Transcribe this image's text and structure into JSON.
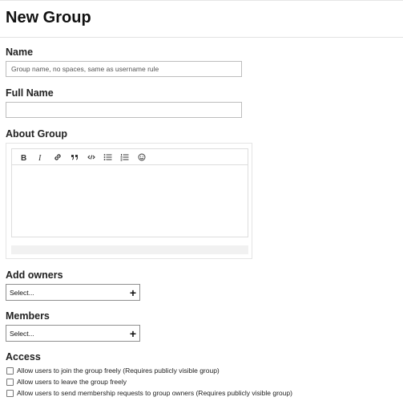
{
  "page": {
    "title": "New Group"
  },
  "fields": {
    "name": {
      "label": "Name",
      "placeholder": "Group name, no spaces, same as username rule",
      "value": ""
    },
    "full_name": {
      "label": "Full Name",
      "placeholder": "",
      "value": ""
    },
    "about": {
      "label": "About Group",
      "toolbar": [
        "bold-icon",
        "italic-icon",
        "link-icon",
        "quote-icon",
        "code-icon",
        "bullet-list-icon",
        "numbered-list-icon",
        "emoji-icon"
      ],
      "value": ""
    },
    "owners": {
      "label": "Add owners",
      "selected": "Select..."
    },
    "members": {
      "label": "Members",
      "selected": "Select..."
    }
  },
  "access": {
    "label": "Access",
    "options": [
      {
        "label": "Allow users to join the group freely (Requires publicly visible group)",
        "checked": false
      },
      {
        "label": "Allow users to leave the group freely",
        "checked": false
      },
      {
        "label": "Allow users to send membership requests to group owners (Requires publicly visible group)",
        "checked": false
      }
    ]
  },
  "colors": {
    "text": "#222222",
    "border": "#bdbdbd",
    "divider": "#e3e3e3"
  }
}
